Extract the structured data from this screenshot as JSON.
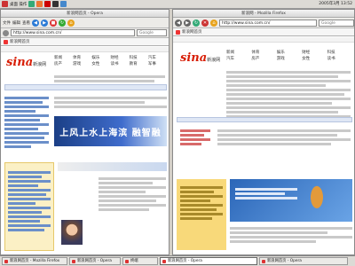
{
  "topbar": {
    "label": "桌面 操作",
    "clock": "2005年3月 13:52"
  },
  "left_window": {
    "title": "新浪网首页 - Opera",
    "toolbar_labels": [
      "文件",
      "编辑",
      "查看"
    ],
    "url": "http://www.sina.com.cn/",
    "search_placeholder": "Google",
    "tab_label": "新浪网首页",
    "logo_text": "sina",
    "logo_sub": "新浪网",
    "nav_items": [
      "新闻",
      "体育",
      "娱乐",
      "财经",
      "科技",
      "汽车",
      "房产",
      "游戏",
      "女性",
      "读书",
      "教育",
      "军事"
    ],
    "banner_text": "上风上水上海滨  融智融"
  },
  "right_window": {
    "title": "新浪网 - Mozilla Firefox",
    "url": "http://www.sina.com.cn/",
    "search_placeholder": "Google",
    "tab_label": "新浪网首页",
    "logo_text": "sina",
    "logo_sub": "新浪网",
    "nav_items": [
      "新闻",
      "体育",
      "娱乐",
      "财经",
      "科技",
      "汽车",
      "房产",
      "游戏",
      "女性",
      "读书"
    ]
  },
  "taskbar": {
    "items": [
      "新浪网首页 - Mozilla Firefox",
      "新浪网首页 - Opera",
      "终端",
      "新浪网首页 - Opera",
      "新浪网首页 - Opera"
    ]
  },
  "colors": {
    "sina_red": "#d81e06",
    "accent_blue": "#1b3f86",
    "section_yellow": "#f7d46b"
  }
}
